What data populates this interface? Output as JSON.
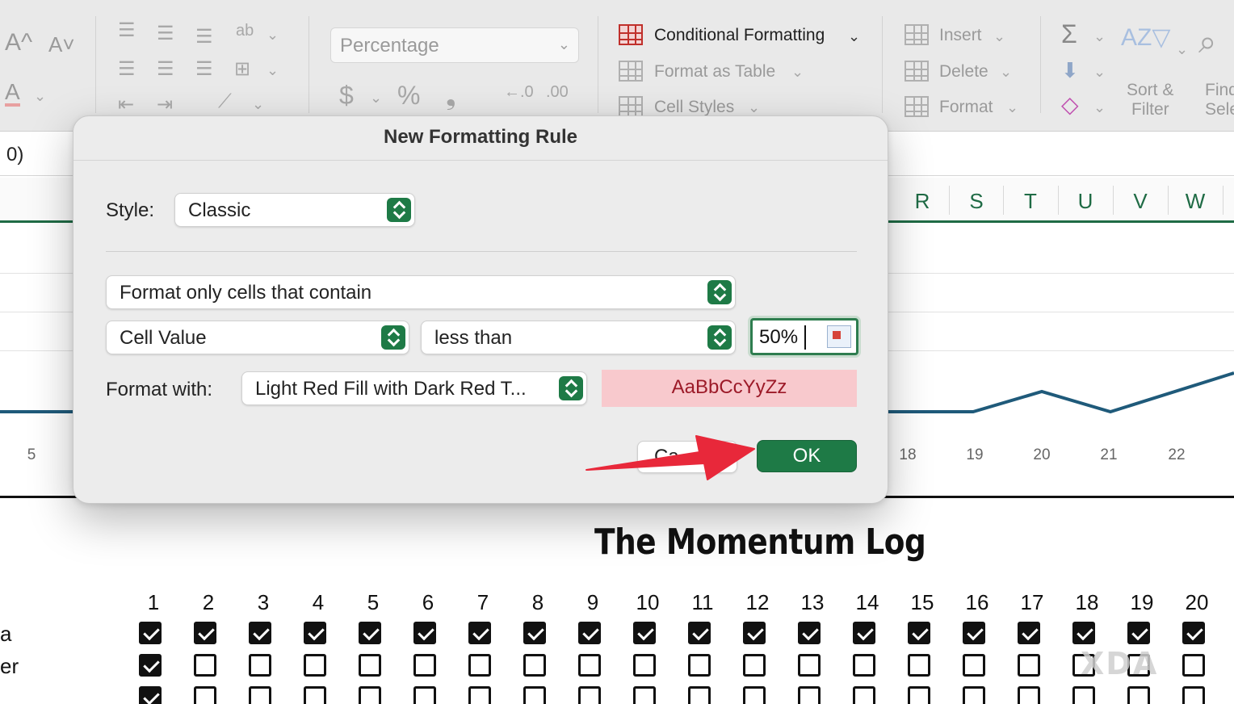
{
  "ribbon": {
    "number_format": "Percentage",
    "conditional_formatting": "Conditional Formatting",
    "format_as_table": "Format as Table",
    "cell_styles": "Cell Styles",
    "insert": "Insert",
    "delete": "Delete",
    "format": "Format",
    "sort_filter_line1": "Sort &",
    "sort_filter_line2": "Filter",
    "find_line1": "Find",
    "find_line2": "Sele"
  },
  "formula_bar": {
    "text": "0)"
  },
  "columns": [
    "R",
    "S",
    "T",
    "U",
    "V",
    "W"
  ],
  "chart_x_labels": [
    "5",
    "18",
    "19",
    "20",
    "21",
    "22"
  ],
  "dialog": {
    "title": "New Formatting Rule",
    "style_label": "Style:",
    "style_value": "Classic",
    "rule_type": "Format only cells that contain",
    "condition_field": "Cell Value",
    "operator": "less than",
    "value": "50%",
    "format_with_label": "Format with:",
    "format_with_value": "Light Red Fill with Dark Red T...",
    "preview_text": "AaBbCcYyZz",
    "cancel_label": "Ca",
    "ok_label": "OK"
  },
  "momentum_log": {
    "title": "The Momentum Log",
    "days": [
      "1",
      "2",
      "3",
      "4",
      "5",
      "6",
      "7",
      "8",
      "9",
      "10",
      "11",
      "12",
      "13",
      "14",
      "15",
      "16",
      "17",
      "18",
      "19",
      "20"
    ],
    "rows": [
      {
        "label": "a",
        "checked": [
          true,
          true,
          true,
          true,
          true,
          true,
          true,
          true,
          true,
          true,
          true,
          true,
          true,
          true,
          true,
          true,
          true,
          true,
          true,
          true
        ]
      },
      {
        "label": "er",
        "checked": [
          true,
          false,
          false,
          false,
          false,
          false,
          false,
          false,
          false,
          false,
          false,
          false,
          false,
          false,
          false,
          false,
          false,
          false,
          false,
          false
        ]
      },
      {
        "label": "",
        "checked": [
          true,
          false,
          false,
          false,
          false,
          false,
          false,
          false,
          false,
          false,
          false,
          false,
          false,
          false,
          false,
          false,
          false,
          false,
          false,
          false
        ]
      }
    ]
  },
  "watermark": "XDA",
  "colors": {
    "excel_green": "#1e7a46",
    "preview_fill": "#f8c9cd",
    "preview_text": "#9c1a28",
    "arrow": "#e8283a",
    "chart_line": "#1f5a7a"
  }
}
